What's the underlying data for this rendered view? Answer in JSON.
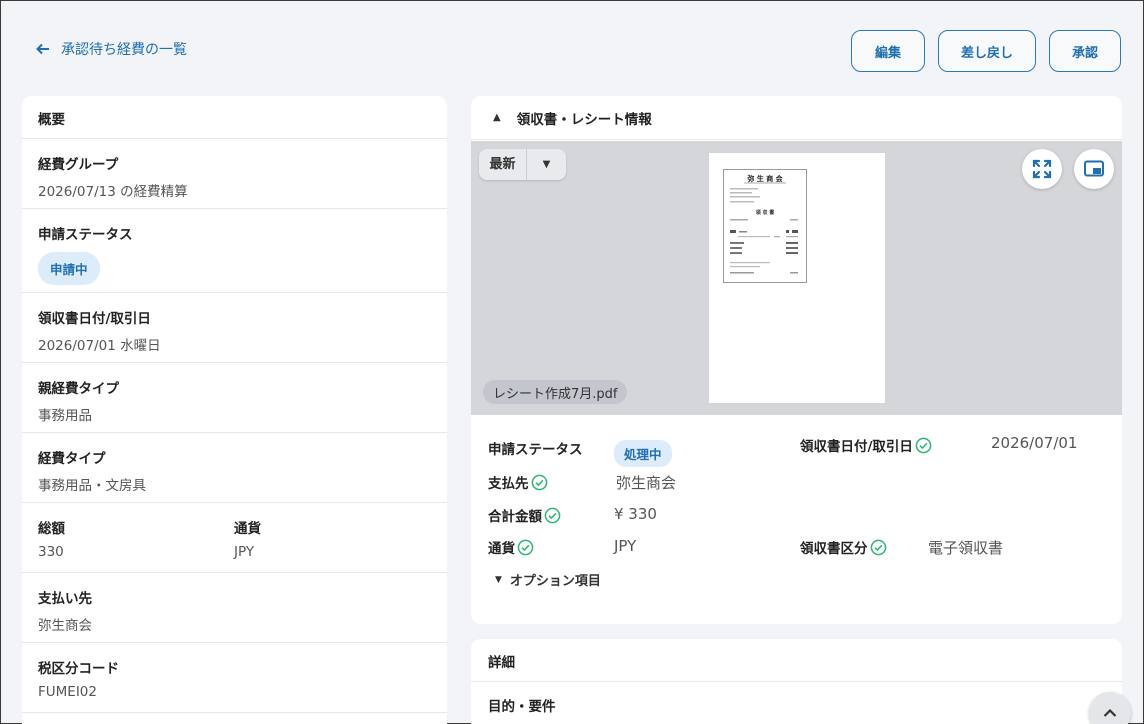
{
  "header": {
    "back_label": "承認待ち経費の一覧",
    "edit_label": "編集",
    "return_label": "差し戻し",
    "approve_label": "承認"
  },
  "summary": {
    "title": "概要",
    "expense_group_label": "経費グループ",
    "expense_group_value": "2026/07/13 の経費精算",
    "status_label": "申請ステータス",
    "status_value": "申請中",
    "receipt_date_label": "領収書日付/取引日",
    "receipt_date_value": "2026/07/01 水曜日",
    "parent_type_label": "親経費タイプ",
    "parent_type_value": "事務用品",
    "type_label": "経費タイプ",
    "type_value": "事務用品・文房具",
    "total_label": "総額",
    "total_value": "330",
    "currency_label": "通貨",
    "currency_value": "JPY",
    "payee_label": "支払い先",
    "payee_value": "弥生商会",
    "tax_label": "税区分コード",
    "tax_value": "FUMEI02"
  },
  "receipt_panel": {
    "title": "領収書・レシート情報",
    "latest_label": "最新",
    "file_name": "レシート作成7月.pdf",
    "receipt_doc_title": "弥 生 商 会",
    "receipt_doc_subtitle": "領 収 書",
    "status_label": "申請ステータス",
    "status_value": "処理中",
    "date_label": "領収書日付/取引日",
    "date_value": "2026/07/01",
    "payee_label": "支払先",
    "payee_value": "弥生商会",
    "amount_label": "合計金額",
    "amount_value": "¥ 330",
    "currency_label": "通貨",
    "currency_value": "JPY",
    "receipt_type_label": "領収書区分",
    "receipt_type_value": "電子領収書",
    "options_label": "オプション項目"
  },
  "details": {
    "title": "詳細",
    "purpose_label": "目的・要件"
  },
  "colors": {
    "accent": "#1f6fb2",
    "check_green": "#2bb673",
    "badge_bg": "#dcecfa"
  }
}
